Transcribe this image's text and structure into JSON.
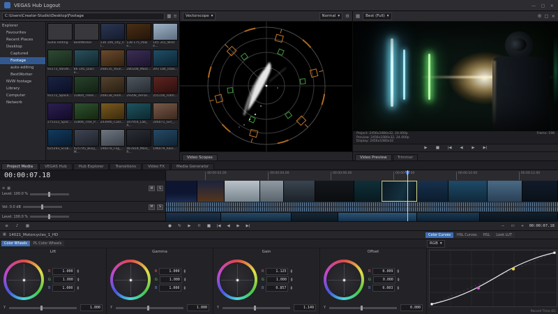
{
  "titlebar": {
    "title": "VEGAS Hub Logout"
  },
  "icons": {
    "menu": "≡",
    "grid": "▦",
    "chevron": "▾",
    "gear": "⚙",
    "close": "×",
    "min": "—",
    "max": "▢",
    "play": "▶",
    "pause": "II",
    "stop": "■",
    "record": "●",
    "loop": "↻",
    "prev": "|◀",
    "next": "▶|",
    "rew": "◀◀",
    "ffwd": "▶▶",
    "back": "◀",
    "note": "♪",
    "plus": "+",
    "minus": "−",
    "box": "▭",
    "up": "▲",
    "down": "▼"
  },
  "explorer": {
    "path": "C:\\Users\\Creator-Studio\\Desktop\\Footage",
    "tree": [
      {
        "label": "Explorer",
        "pad": "3px"
      },
      {
        "label": "Favourites",
        "pad": "9px"
      },
      {
        "label": "Recent Places",
        "pad": "9px"
      },
      {
        "label": "Desktop",
        "pad": "9px"
      },
      {
        "label": "Captured",
        "pad": "15px"
      },
      {
        "label": "Footage",
        "pad": "15px",
        "active": true
      },
      {
        "label": "auto-editing",
        "pad": "15px"
      },
      {
        "label": "BestWorker",
        "pad": "15px"
      },
      {
        "label": "NVW footage",
        "pad": "9px"
      },
      {
        "label": "Library",
        "pad": "9px"
      },
      {
        "label": "Computer",
        "pad": "9px"
      },
      {
        "label": "Network",
        "pad": "9px"
      }
    ],
    "files": [
      {
        "label": "audio editing",
        "bg": "#37373c"
      },
      {
        "label": "BestWorker",
        "bg": "#37373c"
      },
      {
        "label": "136 106_city_ni...",
        "bg": "linear-gradient(160deg,#2b3652,#141b2d)"
      },
      {
        "label": "138 175_Powe...",
        "bg": "linear-gradient(160deg,#4a2f16,#231408)"
      },
      {
        "label": "145 315_Winte...",
        "bg": "linear-gradient(160deg,#a0b3c5,#5c6e81)"
      },
      {
        "label": "93173_Vande...",
        "bg": "linear-gradient(160deg,#2e4a33,#16271a)"
      },
      {
        "label": "86 195_Glacie...",
        "bg": "linear-gradient(160deg,#29505c,#10242b)"
      },
      {
        "label": "208135_Youn...",
        "bg": "linear-gradient(160deg,#6a4a2e,#32210f)"
      },
      {
        "label": "280208_Mosc...",
        "bg": "linear-gradient(160deg,#3c2e52,#1c1430)"
      },
      {
        "label": "293 184_Islan...",
        "bg": "linear-gradient(160deg,#1f4e66,#0c2331)"
      },
      {
        "label": "93172_Space...",
        "bg": "linear-gradient(160deg,#1a2344,#0a0f22)"
      },
      {
        "label": "31804_Trees...",
        "bg": "linear-gradient(160deg,#27412a,#122114)"
      },
      {
        "label": "208138_Hom...",
        "bg": "linear-gradient(160deg,#54422e,#281e12)"
      },
      {
        "label": "29208_Aerial...",
        "bg": "linear-gradient(160deg,#4e565e,#262b30)"
      },
      {
        "label": "255156_Flam...",
        "bg": "linear-gradient(160deg,#5e2420,#2c0f0d)"
      },
      {
        "label": "275312_Spac...",
        "bg": "linear-gradient(160deg,#2c2050,#120a28)"
      },
      {
        "label": "31806_Tree_P...",
        "bg": "linear-gradient(160deg,#2f5230,#14260f)"
      },
      {
        "label": "243946_Cass...",
        "bg": "linear-gradient(160deg,#7a5a20,#3a2a0c)"
      },
      {
        "label": "347954_Lab_A...",
        "bg": "linear-gradient(160deg,#1e5560,#0c272e)"
      },
      {
        "label": "246071_Girl_...",
        "bg": "linear-gradient(160deg,#7a5a48,#3a281e)"
      },
      {
        "label": "625293_Scub...",
        "bg": "linear-gradient(160deg,#123a5e,#081c30)"
      },
      {
        "label": "425745_Busy_M...",
        "bg": "linear-gradient(160deg,#3e4452,#1d2129)"
      },
      {
        "label": "196078_Fog_...",
        "bg": "linear-gradient(160deg,#6e7680,#3a4048)"
      },
      {
        "label": "467819_Main_R...",
        "bg": "linear-gradient(160deg,#2a2d34,#121418)"
      },
      {
        "label": "196079_Rain...",
        "bg": "linear-gradient(160deg,#254a66,#102433)"
      }
    ]
  },
  "scope": {
    "type_label": "Vectorscope",
    "mode_label": "Normal",
    "footer_tab": "Video Scopes"
  },
  "preview": {
    "quality_label": "Best (Full)",
    "info": {
      "project": "Project: 2456x1080x32, 24.000p",
      "preview": "Preview: 2456x1080x32, 24.000p",
      "display": "Display: 2456x1080x32",
      "frame": "Frame: 198"
    },
    "transport": [
      "▶",
      "■",
      "|◀",
      "◀",
      "▶",
      "▶|"
    ],
    "tabs": [
      {
        "label": "Video Preview",
        "active": true
      },
      {
        "label": "Trimmer"
      }
    ]
  },
  "dock_tabs": [
    {
      "label": "Project Media",
      "active": true
    },
    {
      "label": "VEGAS Hub"
    },
    {
      "label": "Hub Explorer"
    },
    {
      "label": "Transitions"
    },
    {
      "label": "Video FX"
    },
    {
      "label": "Media Generator"
    }
  ],
  "timeline": {
    "timecode": "00:00:07.18",
    "end_timecode": "00:00:07.18",
    "playhead_pct": 61.5,
    "mute": "M",
    "solo": "S",
    "ruler_ticks": [
      {
        "label": "00:00:02.00",
        "left": "10%"
      },
      {
        "label": "00:00:04.00",
        "left": "26%"
      },
      {
        "label": "00:00:06.00",
        "left": "42%"
      },
      {
        "label": "00:00:08.00",
        "left": "58%"
      },
      {
        "label": "00:00:10.00",
        "left": "74%"
      },
      {
        "label": "00:00:12.00",
        "left": "90%"
      }
    ],
    "tracks": {
      "video": {
        "level": "Level: 100.0 %"
      },
      "audio": {
        "level": "Vol: 0.0 dB"
      },
      "video2": {
        "level": "Level: 100.0 %"
      }
    },
    "clips": [
      {
        "w": "8%",
        "bg": "linear-gradient(180deg,#0d1530 60%,#1c2a50)"
      },
      {
        "w": "7%",
        "bg": "linear-gradient(180deg,#1a2340,#55351c)"
      },
      {
        "w": "9%",
        "bg": "linear-gradient(180deg,#b9c2c9,#78848d)"
      },
      {
        "w": "6%",
        "bg": "linear-gradient(180deg,#8f9aa3,#5a646d)"
      },
      {
        "w": "8%",
        "bg": "linear-gradient(180deg,#3a4450,#1c2229)"
      },
      {
        "w": "10%",
        "bg": "linear-gradient(180deg,#14171c,#0b0d10)"
      },
      {
        "w": "7%",
        "bg": "linear-gradient(180deg,#0f2f38,#081a20)"
      },
      {
        "w": "9%",
        "bg": "linear-gradient(110deg,#0c1a24,#14303e 60%,#0a141c)",
        "selected": true
      },
      {
        "w": "8%",
        "bg": "linear-gradient(180deg,#16304c,#0c1c2e)"
      },
      {
        "w": "10%",
        "bg": "linear-gradient(180deg,#1e4a68,#102a3c)"
      },
      {
        "w": "9%",
        "bg": "linear-gradient(180deg,#4a6a85,#2a4056)"
      },
      {
        "w": "9%",
        "bg": "linear-gradient(180deg,#101b2a,#0a1018)"
      }
    ],
    "clips2": [
      {
        "w": "14%",
        "bg": "linear-gradient(180deg,#1d3350,#10202e)"
      },
      {
        "w": "18%",
        "bg": "linear-gradient(180deg,#254a6a,#14293a)"
      },
      {
        "w": "12%",
        "bg": "linear-gradient(180deg,#152838,#0c1820)"
      },
      {
        "w": "20%",
        "bg": "linear-gradient(180deg,#2a5578,#16304a)"
      },
      {
        "w": "16%",
        "bg": "linear-gradient(180deg,#1a3a55,#0e2030)"
      },
      {
        "w": "20%",
        "bg": "linear-gradient(180deg,#10202e,#0a141c)"
      }
    ]
  },
  "transport": {
    "left_icons": [
      "≡",
      "♪",
      "▦"
    ],
    "buttons": [
      "●",
      "↻",
      "▶",
      "II",
      "■",
      "|◀",
      "◀",
      "▶",
      "▶|"
    ],
    "zoom": [
      "−",
      "▭",
      "+"
    ]
  },
  "grading": {
    "event_title": "14021_Motorcycles_1_HD",
    "tabs": [
      {
        "label": "Color Wheels",
        "active": true
      },
      {
        "label": "PL Color Wheels"
      }
    ],
    "rgb_labels": [
      "R",
      "G",
      "B"
    ],
    "y_label": "Y",
    "wheels": [
      {
        "label": "Lift",
        "r": "1.000",
        "g": "1.000",
        "b": "1.000",
        "y": "1.000"
      },
      {
        "label": "Gamma",
        "r": "1.000",
        "g": "1.000",
        "b": "1.000",
        "y": "1.000"
      },
      {
        "label": "Gain",
        "r": "1.125",
        "g": "1.000",
        "b": "0.857",
        "y": "1.149"
      },
      {
        "label": "Offset",
        "r": "0.009",
        "g": "0.000",
        "b": "0.003",
        "y": "0.000"
      }
    ],
    "curves": {
      "tabs": [
        {
          "label": "Color Curves",
          "active": true
        },
        {
          "label": "HSL Curves"
        },
        {
          "label": "HSL"
        },
        {
          "label": "Look LUT"
        }
      ],
      "channel": "RGB",
      "status": "Record Time (E):"
    }
  },
  "colors": {
    "accent_blue": "#3d6fb4",
    "selection_blue": "#31598f",
    "scope_orange": "#c87a28",
    "scope_green": "#3f9b3f",
    "playhead": "#4a80d0"
  }
}
